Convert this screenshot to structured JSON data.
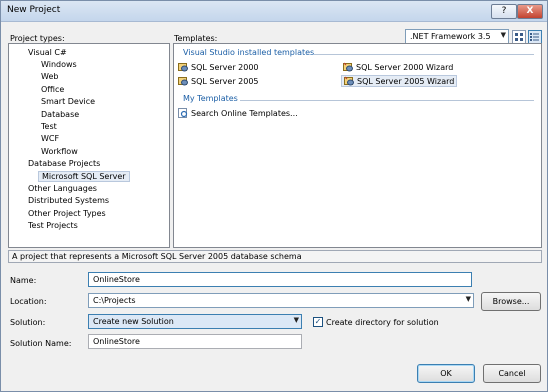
{
  "window": {
    "title": "New Project",
    "help_btn": "?",
    "close_btn": "X"
  },
  "labels": {
    "project_types": "Project types:",
    "templates": "Templates:",
    "name": "Name:",
    "location": "Location:",
    "solution": "Solution:",
    "solution_name": "Solution Name:"
  },
  "framework": {
    "selected": ".NET Framework 3.5"
  },
  "project_types": [
    {
      "label": "Visual C#",
      "level": 0
    },
    {
      "label": "Windows",
      "level": 1
    },
    {
      "label": "Web",
      "level": 1
    },
    {
      "label": "Office",
      "level": 1
    },
    {
      "label": "Smart Device",
      "level": 1
    },
    {
      "label": "Database",
      "level": 1
    },
    {
      "label": "Test",
      "level": 1
    },
    {
      "label": "WCF",
      "level": 1
    },
    {
      "label": "Workflow",
      "level": 1
    },
    {
      "label": "Database Projects",
      "level": 0
    },
    {
      "label": "Microsoft SQL Server",
      "level": 1,
      "selected": true
    },
    {
      "label": "Other Languages",
      "level": 0
    },
    {
      "label": "Distributed Systems",
      "level": 0
    },
    {
      "label": "Other Project Types",
      "level": 0
    },
    {
      "label": "Test Projects",
      "level": 0
    }
  ],
  "templates": {
    "installed_header": "Visual Studio installed templates",
    "installed": [
      {
        "label": "SQL Server 2000",
        "icon": "sql-project-icon"
      },
      {
        "label": "SQL Server 2000 Wizard",
        "icon": "sql-wizard-icon"
      },
      {
        "label": "SQL Server 2005",
        "icon": "sql-project-icon"
      },
      {
        "label": "SQL Server 2005 Wizard",
        "icon": "sql-wizard-icon",
        "selected": true
      }
    ],
    "my_header": "My Templates",
    "my": [
      {
        "label": "Search Online Templates...",
        "icon": "search-online-icon"
      }
    ]
  },
  "description": "A project that represents a Microsoft SQL Server 2005 database schema",
  "fields": {
    "name": "OnlineStore",
    "location": "C:\\Projects",
    "solution": "Create new Solution",
    "create_directory_label": "Create directory for solution",
    "create_directory_checked": true,
    "solution_name": "OnlineStore"
  },
  "buttons": {
    "browse": "Browse...",
    "ok": "OK",
    "cancel": "Cancel"
  },
  "icons": {
    "view_large": "large-icons-view-icon",
    "view_small": "small-icons-view-icon"
  }
}
